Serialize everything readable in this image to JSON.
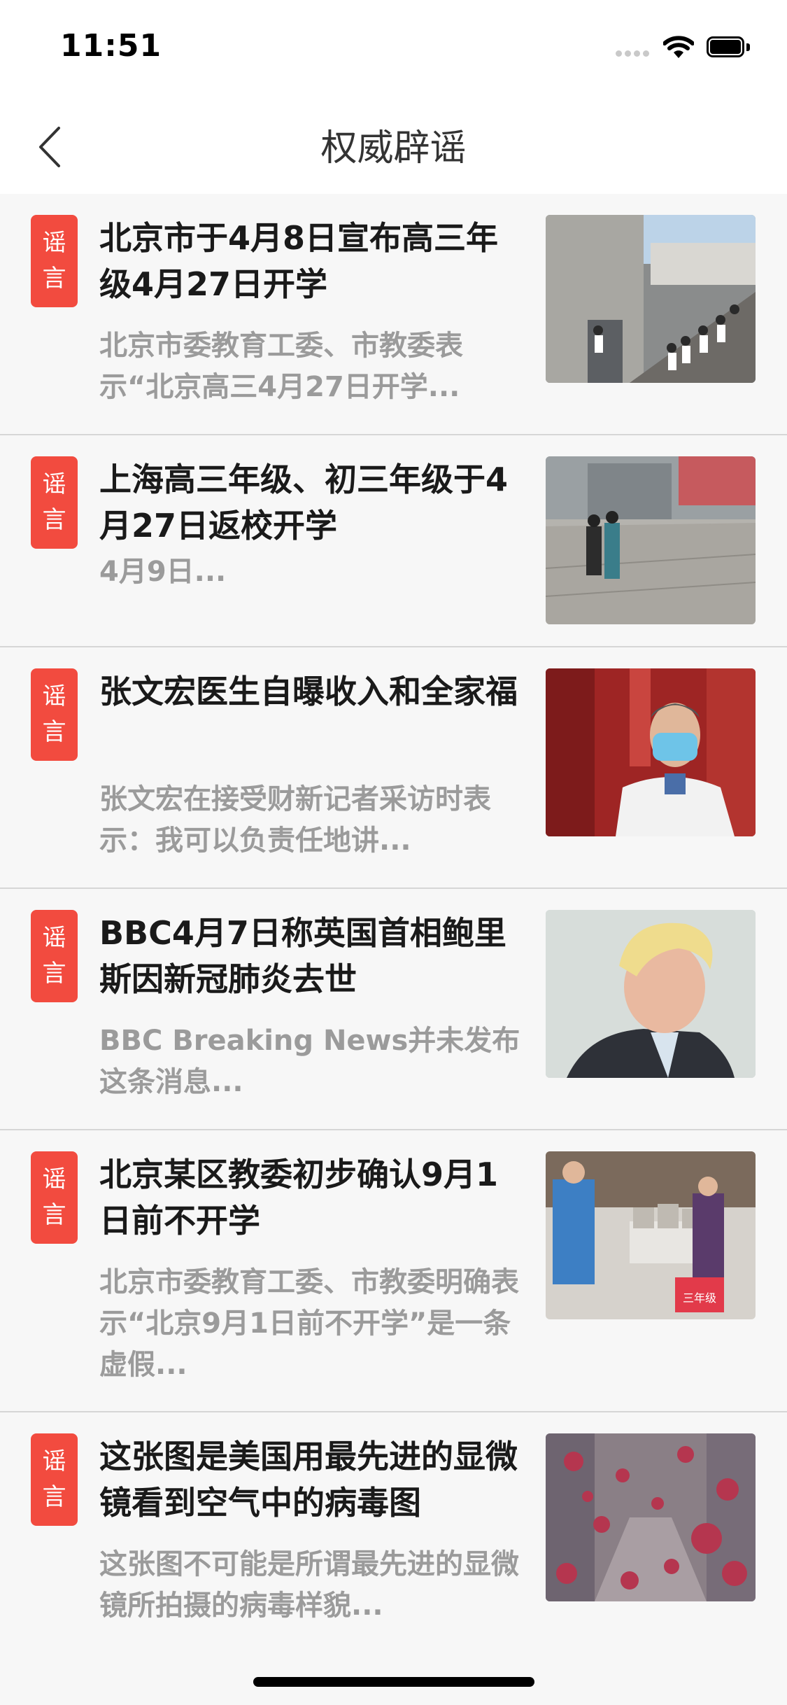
{
  "status_bar": {
    "time": "11:51"
  },
  "nav": {
    "title": "权威辟谣"
  },
  "badge": {
    "line1": "谣",
    "line2": "言"
  },
  "items": [
    {
      "title": "北京市于4月8日宣布高三年级4月27日开学",
      "desc": "北京市委教育工委、市教委表示“北京高三4月27日开学...",
      "image": "students-on-campus-stairs"
    },
    {
      "title": "上海高三年级、初三年级于4月27日返校开学",
      "desc": "4月9日...",
      "image": "students-walking-in-schoolyard"
    },
    {
      "title": "张文宏医生自曝收入和全家福",
      "desc": "张文宏在接受财新记者采访时表示：我可以负责任地讲...",
      "image": "doctor-in-mask-portrait"
    },
    {
      "title": "BBC4月7日称英国首相鲍里斯因新冠肺炎去世",
      "desc": "BBC Breaking News并未发布这条消息...",
      "image": "politician-portrait"
    },
    {
      "title": "北京某区教委初步确认9月1日前不开学",
      "desc": "北京市委教育工委、市教委明确表示“北京9月1日前不开学”是一条虚假...",
      "image": "teachers-distributing-books",
      "image_sign": "三年级"
    },
    {
      "title": "这张图是美国用最先进的显微镜看到空气中的病毒图",
      "desc": "这张图不可能是所谓最先进的显微镜所拍摄的病毒样貌...",
      "image": "virus-particles-over-city-street"
    }
  ]
}
